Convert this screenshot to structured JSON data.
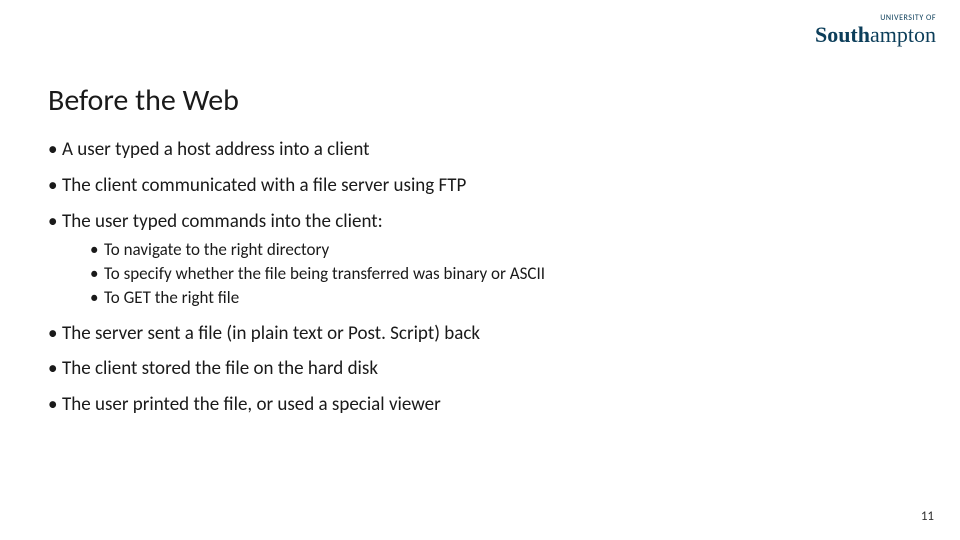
{
  "logo": {
    "tagline": "UNIVERSITY OF",
    "name_prefix": "South",
    "name_suffix": "ampton"
  },
  "title": "Before the Web",
  "bullets": [
    {
      "text": "A user typed a host address into a client"
    },
    {
      "text": "The client communicated with a file server using FTP"
    },
    {
      "text": "The user typed commands into the client:",
      "sub": [
        "To navigate to the right directory",
        "To specify whether the file being transferred was binary or ASCII",
        "To GET the right file"
      ]
    },
    {
      "text": "The server sent a file (in plain text or Post. Script) back"
    },
    {
      "text": "The client stored the file on the hard disk"
    },
    {
      "text": "The user printed the file, or used a special viewer"
    }
  ],
  "page_number": "11"
}
